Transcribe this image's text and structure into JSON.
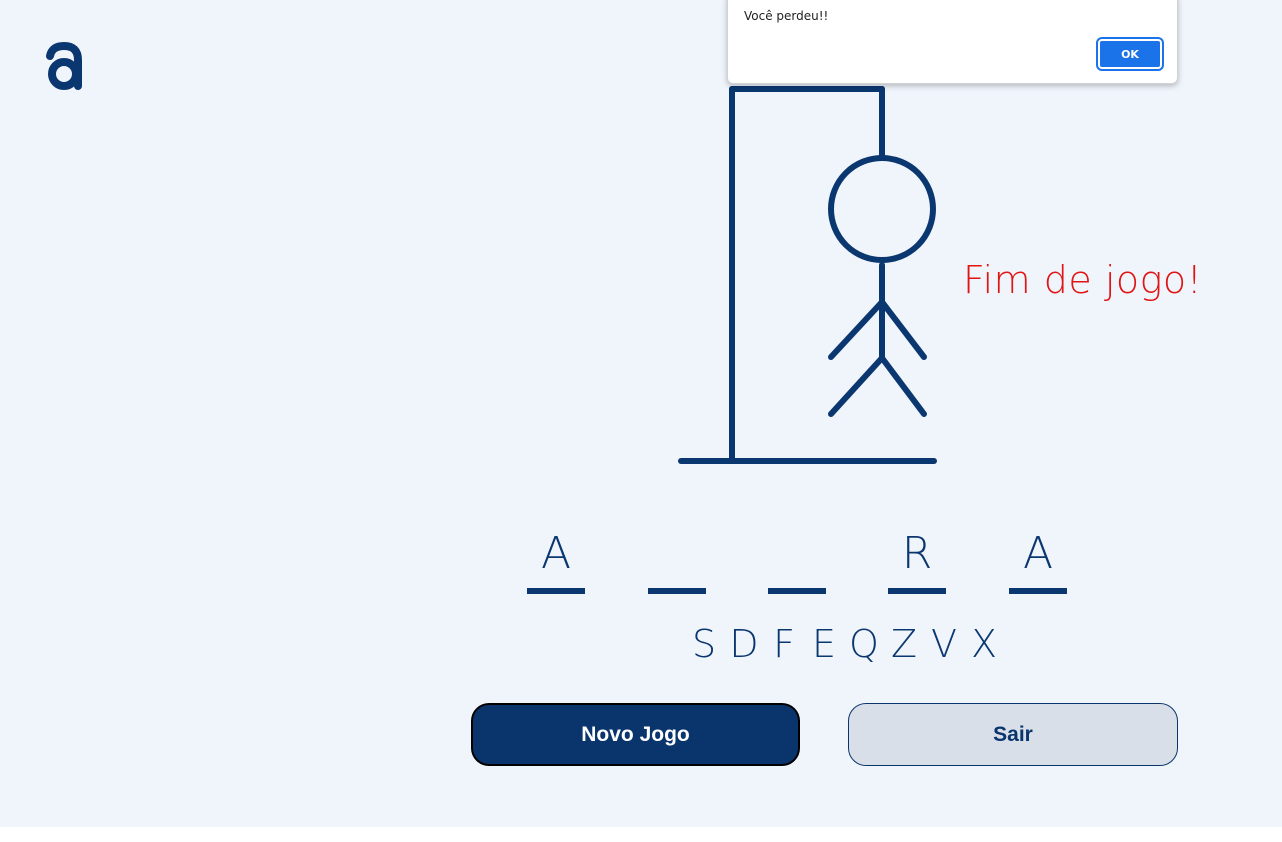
{
  "theme": {
    "navy": "#0b3770",
    "red": "#e01414",
    "background": "#f0f4fb",
    "dialog_button": "#1a73e8"
  },
  "logo": {
    "icon": "letter-a-logo-icon"
  },
  "game": {
    "status": "Fim de jogo!",
    "word_slots": [
      "A",
      "",
      "",
      "R",
      "A"
    ],
    "wrong_letters": [
      "S",
      "D",
      "F",
      "E",
      "Q",
      "Z",
      "V",
      "X"
    ],
    "hangman_parts": [
      "head",
      "body",
      "left-arm",
      "right-arm",
      "left-leg",
      "right-leg"
    ]
  },
  "buttons": {
    "new_game": "Novo Jogo",
    "exit": "Sair"
  },
  "alert": {
    "message": "Você perdeu!!",
    "ok_label": "OK"
  }
}
